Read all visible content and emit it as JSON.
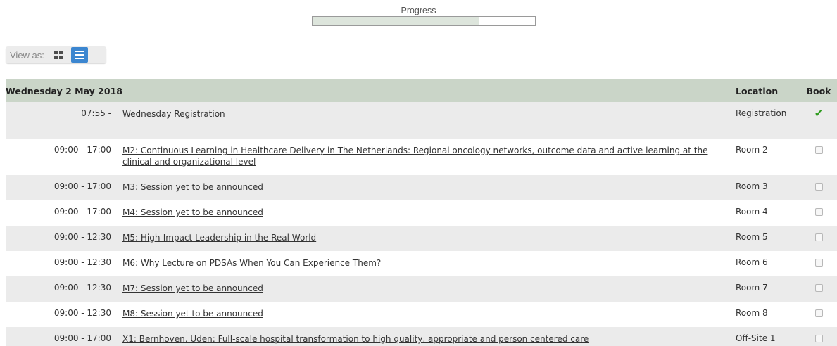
{
  "progress": {
    "label": "Progress",
    "fraction": 0.75
  },
  "view_as": {
    "label": "View as:",
    "modes": [
      "grid",
      "list"
    ],
    "active": "list"
  },
  "schedule": {
    "day": "Wednesday 2 May 2018",
    "location_header": "Location",
    "book_header": "Book",
    "rows": [
      {
        "time": "07:55 -",
        "title": "Wednesday Registration",
        "link": false,
        "location": "Registration",
        "booked": true
      },
      {
        "time": "09:00 - 17:00",
        "title": "M2: Continuous Learning in Healthcare Delivery in The Netherlands: Regional oncology networks, outcome data and active learning at the clinical and organizational level",
        "link": true,
        "location": "Room 2",
        "booked": false
      },
      {
        "time": "09:00 - 17:00",
        "title": "M3: Session yet to be announced",
        "link": true,
        "location": "Room 3",
        "booked": false
      },
      {
        "time": "09:00 - 17:00",
        "title": "M4: Session yet to be announced",
        "link": true,
        "location": "Room 4",
        "booked": false
      },
      {
        "time": "09:00 - 12:30",
        "title": "M5: High-Impact Leadership in the Real World",
        "link": true,
        "location": "Room 5",
        "booked": false
      },
      {
        "time": "09:00 - 12:30",
        "title": "M6: Why Lecture on PDSAs When You Can Experience Them?",
        "link": true,
        "location": "Room 6",
        "booked": false
      },
      {
        "time": "09:00 - 12:30",
        "title": "M7: Session yet to be announced",
        "link": true,
        "location": "Room 7",
        "booked": false
      },
      {
        "time": "09:00 - 12:30",
        "title": "M8: Session yet to be announced",
        "link": true,
        "location": "Room 8",
        "booked": false
      },
      {
        "time": "09:00 - 17:00",
        "title": "X1: Bernhoven, Uden: Full-scale hospital transformation to high quality, appropriate and person centered care",
        "link": true,
        "location": "Off-Site 1",
        "booked": false
      }
    ]
  },
  "colors": {
    "header_bg": "#cad5c8",
    "alt_row_bg": "#ebebeb",
    "active_view": "#3b86d0",
    "check": "#2e9b1e",
    "progress_fill": "#dde5dc"
  }
}
